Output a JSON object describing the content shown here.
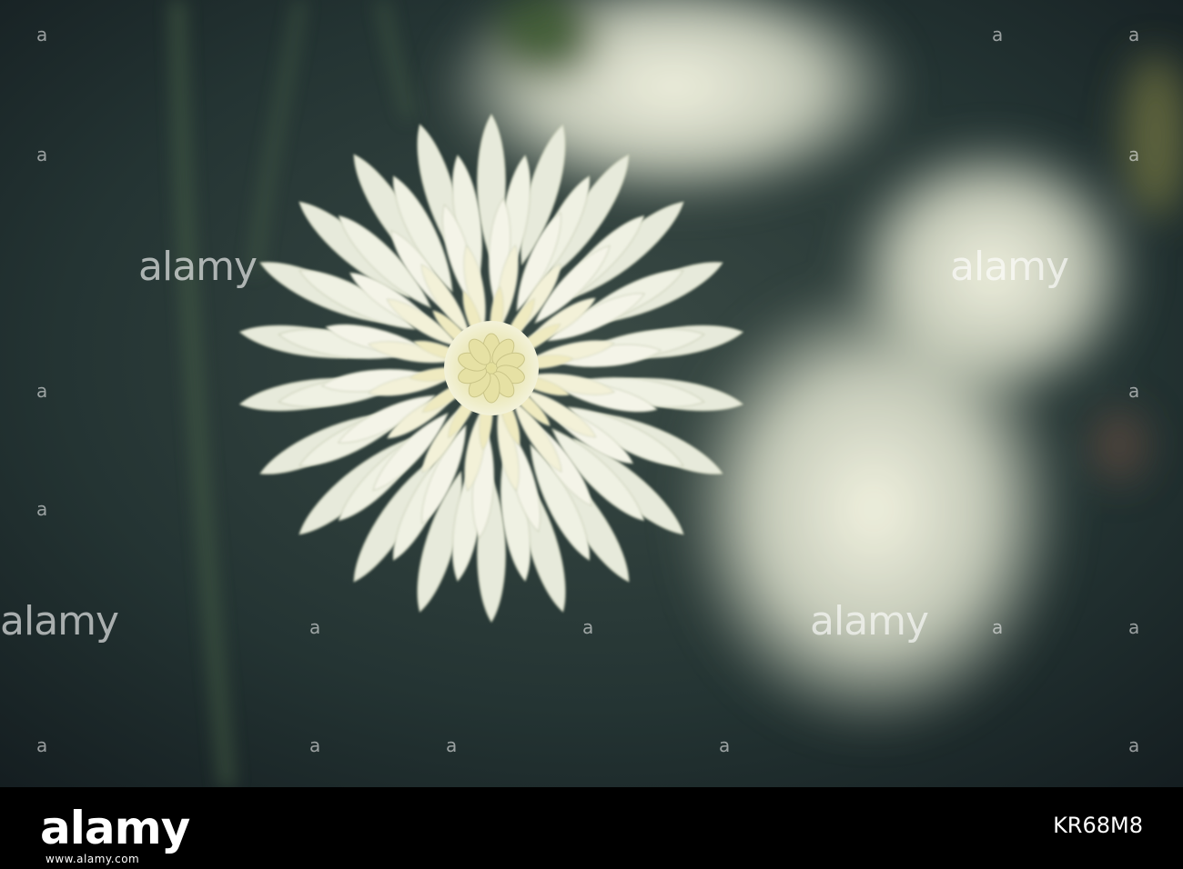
{
  "photo": {
    "subject": "flower-photo",
    "colors": {
      "background": "#1f2e2f",
      "petal": "#f2f3e6",
      "center": "#e8e4a6"
    }
  },
  "watermark": {
    "text": "alamy",
    "glyph": "a"
  },
  "footer": {
    "logo": "alamy",
    "subtext": "www.alamy.com",
    "image_id": "KR68M8"
  }
}
